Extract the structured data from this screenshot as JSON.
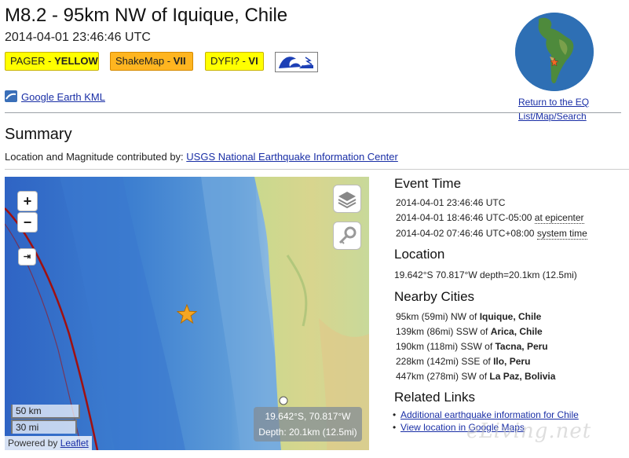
{
  "header": {
    "title": "M8.2 - 95km NW of Iquique, Chile",
    "datetime": "2014-04-01 23:46:46 UTC"
  },
  "badges": {
    "pager_label": "PAGER - ",
    "pager_value": "YELLOW",
    "shakemap_label": "ShakeMap - ",
    "shakemap_value": "VII",
    "dyfi_label": "DYFI? - ",
    "dyfi_value": "VI"
  },
  "kml_link": "Google Earth KML",
  "return_link": [
    "Return to the EQ",
    "List/Map/Search"
  ],
  "summary": {
    "heading": "Summary",
    "contrib_prefix": "Location and Magnitude contributed by: ",
    "contrib_link": "USGS National Earthquake Information Center"
  },
  "map": {
    "zoom_in": "+",
    "zoom_out": "−",
    "scale_km": "50 km",
    "scale_mi": "30 mi",
    "coord_line": "19.642°S, 70.817°W",
    "depth_line": "Depth: 20.1km (12.5mi)",
    "attribution_prefix": "Powered by ",
    "attribution_link": "Leaflet"
  },
  "event_time": {
    "heading": "Event Time",
    "utc": "2014-04-01 23:46:46 UTC",
    "epicenter_time": "2014-04-01 18:46:46 UTC-05:00",
    "epicenter_label": "at epicenter",
    "system_time": "2014-04-02 07:46:46 UTC+08:00",
    "system_label": "system time"
  },
  "location": {
    "heading": "Location",
    "value": "19.642°S 70.817°W depth=20.1km (12.5mi)"
  },
  "nearby": {
    "heading": "Nearby Cities",
    "cities": [
      {
        "prefix": "95km (59mi) NW of ",
        "place": "Iquique, Chile"
      },
      {
        "prefix": "139km (86mi) SSW of ",
        "place": "Arica, Chile"
      },
      {
        "prefix": "190km (118mi) SSW of ",
        "place": "Tacna, Peru"
      },
      {
        "prefix": "228km (142mi) SSE of ",
        "place": "Ilo, Peru"
      },
      {
        "prefix": "447km (278mi) SW of ",
        "place": "La Paz, Bolivia"
      }
    ]
  },
  "related": {
    "heading": "Related Links",
    "links": [
      "Additional earthquake information for Chile",
      "View location in Google Maps"
    ]
  },
  "watermark": "eLiving.net",
  "colors": {
    "pager": "#ffff00",
    "shakemap": "#ffb520",
    "dyfi": "#ffff00",
    "link": "#1a2fa6",
    "star": "#f5a623",
    "plate_boundary": "#a01010"
  }
}
